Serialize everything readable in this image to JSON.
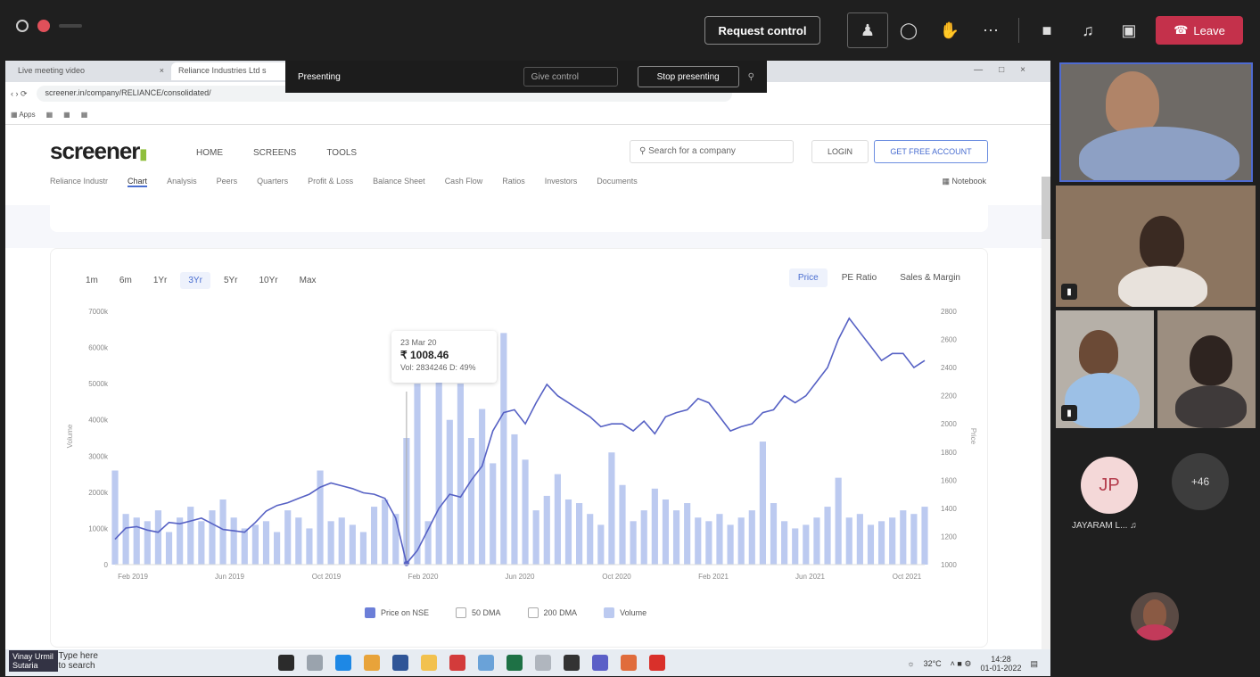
{
  "teams": {
    "request_control": "Request control",
    "leave": "Leave",
    "more_participants": "+46",
    "participant_initials": "JP",
    "participant_name": "JAYARAM L..."
  },
  "presenting_bar": {
    "status": "Presenting",
    "give_control": "Give control",
    "stop_presenting": "Stop presenting"
  },
  "browser": {
    "tabs": [
      "Live meeting video",
      "Reliance Industries Ltd s"
    ],
    "url": "screener.in/company/RELIANCE/consolidated/"
  },
  "site": {
    "logo": "screener",
    "nav": [
      "HOME",
      "SCREENS",
      "TOOLS"
    ],
    "search_placeholder": "Search for a company",
    "login": "LOGIN",
    "get_free": "GET FREE ACCOUNT",
    "subnav": [
      "Reliance Industr",
      "Chart",
      "Analysis",
      "Peers",
      "Quarters",
      "Profit & Loss",
      "Balance Sheet",
      "Cash Flow",
      "Ratios",
      "Investors",
      "Documents"
    ],
    "notebook": "Notebook"
  },
  "chart_controls": {
    "periods": [
      "1m",
      "6m",
      "1Yr",
      "3Yr",
      "5Yr",
      "10Yr",
      "Max"
    ],
    "active_period": "3Yr",
    "modes": [
      "Price",
      "PE Ratio",
      "Sales & Margin"
    ]
  },
  "tooltip": {
    "date": "23 Mar 20",
    "price": "₹ 1008.46",
    "vol": "Vol: 2834246 D: 49%"
  },
  "chart_data": {
    "type": "line",
    "title": "",
    "x_ticks": [
      "Feb 2019",
      "Jun 2019",
      "Oct 2019",
      "Feb 2020",
      "Jun 2020",
      "Oct 2020",
      "Feb 2021",
      "Jun 2021",
      "Oct 2021"
    ],
    "y_left_ticks": [
      "0",
      "1000k",
      "2000k",
      "3000k",
      "4000k",
      "5000k",
      "6000k",
      "7000k"
    ],
    "y_right_ticks": [
      "1000",
      "1200",
      "1400",
      "1600",
      "1800",
      "2000",
      "2200",
      "2400",
      "2600",
      "2800"
    ],
    "ylabel_left": "Volume",
    "ylabel_right": "Price",
    "ylim_price": [
      1000,
      2800
    ],
    "ylim_volume": [
      0,
      7000000
    ],
    "price_series": {
      "name": "Price on NSE",
      "values": [
        1180,
        1260,
        1270,
        1245,
        1230,
        1300,
        1290,
        1310,
        1330,
        1290,
        1250,
        1240,
        1230,
        1300,
        1380,
        1420,
        1440,
        1470,
        1500,
        1550,
        1580,
        1560,
        1540,
        1510,
        1500,
        1470,
        1330,
        1008,
        1100,
        1250,
        1400,
        1500,
        1480,
        1600,
        1700,
        1950,
        2080,
        2100,
        2000,
        2150,
        2280,
        2200,
        2150,
        2100,
        2050,
        1980,
        2000,
        2000,
        1950,
        2020,
        1930,
        2050,
        2080,
        2100,
        2180,
        2150,
        2050,
        1950,
        1980,
        2000,
        2080,
        2100,
        2200,
        2150,
        2200,
        2300,
        2400,
        2600,
        2750,
        2650,
        2550,
        2450,
        2500,
        2500,
        2400,
        2450
      ]
    },
    "volume_series": {
      "name": "Volume",
      "values": [
        2600,
        1400,
        1300,
        1200,
        1500,
        900,
        1300,
        1600,
        1200,
        1500,
        1800,
        1300,
        1000,
        1100,
        1200,
        900,
        1500,
        1300,
        1000,
        2600,
        1200,
        1300,
        1100,
        900,
        1600,
        1800,
        1400,
        3500,
        5000,
        1200,
        6100,
        4000,
        5000,
        3500,
        4300,
        2800,
        6400,
        3600,
        2900,
        1500,
        1900,
        2500,
        1800,
        1700,
        1400,
        1100,
        3100,
        2200,
        1200,
        1500,
        2100,
        1800,
        1500,
        1700,
        1300,
        1200,
        1400,
        1100,
        1300,
        1500,
        3400,
        1700,
        1200,
        1000,
        1100,
        1300,
        1600,
        2400,
        1300,
        1400,
        1100,
        1200,
        1300,
        1500,
        1400,
        1600
      ]
    }
  },
  "legend": [
    "Price on NSE",
    "50 DMA",
    "200 DMA",
    "Volume"
  ],
  "taskbar": {
    "search_label": "Type here to search",
    "speaker_label": "Vinay Urmil Sutaria",
    "temp": "32°C",
    "time": "14:28",
    "date": "01-01-2022"
  },
  "colors": {
    "teams_bg": "#1f1f1f",
    "leave": "#c4314b",
    "price_line": "#5661c4",
    "volume_bar": "#bccaf0"
  }
}
